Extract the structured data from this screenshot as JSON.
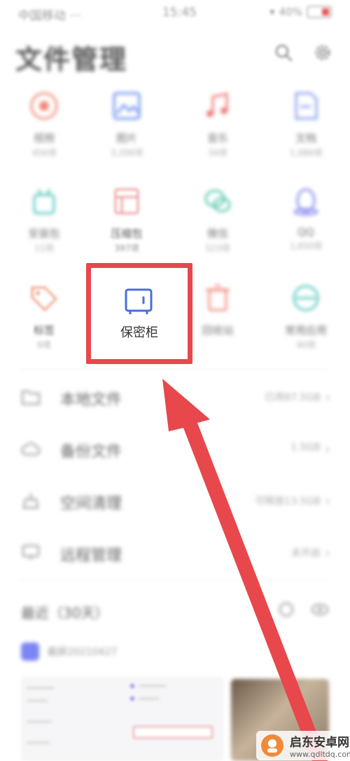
{
  "status_bar": {
    "carrier": "中国移动 ···",
    "time": "15:45",
    "battery": "40%"
  },
  "header": {
    "title": "文件管理"
  },
  "categories": [
    {
      "label": "视频",
      "count": "456项",
      "color": "#f08a7a"
    },
    {
      "label": "图片",
      "count": "3,206项",
      "color": "#6b8ff0"
    },
    {
      "label": "音乐",
      "count": "34项",
      "color": "#f07a7a"
    },
    {
      "label": "文档",
      "count": "1,086项",
      "color": "#8aa0f0"
    },
    {
      "label": "安装包",
      "count": "11项",
      "color": "#5cc8c0"
    },
    {
      "label": "压缩包",
      "count": "397项",
      "color": "#f0a0a0"
    },
    {
      "label": "微信",
      "count": "523项",
      "color": "#5cc8b0"
    },
    {
      "label": "QQ",
      "count": "1,650项",
      "color": "#8a90f0"
    },
    {
      "label": "标签",
      "count": "0项",
      "color": "#f0a080"
    },
    {
      "label": "回收站",
      "count": "",
      "color": "#f09080"
    },
    {
      "label": "常用应用",
      "count": "40项",
      "color": "#5cc8c0"
    }
  ],
  "vault": {
    "label": "保密柜",
    "icon_color": "#4a6fd8"
  },
  "storage_list": [
    {
      "label": "本地文件",
      "value": "已用87.5GB"
    },
    {
      "label": "备份文件",
      "value": "1.5GB"
    },
    {
      "label": "空间清理",
      "value": "可释放13.5GB"
    },
    {
      "label": "远程管理",
      "value": "未开启"
    }
  ],
  "recent": {
    "title": "最近（30天）",
    "item_name": "截屏20210427"
  },
  "watermark": {
    "name": "启东安卓网",
    "url": "www.qdltdq.com"
  },
  "colors": {
    "highlight": "#e8474b",
    "accent": "#4a6fd8"
  }
}
